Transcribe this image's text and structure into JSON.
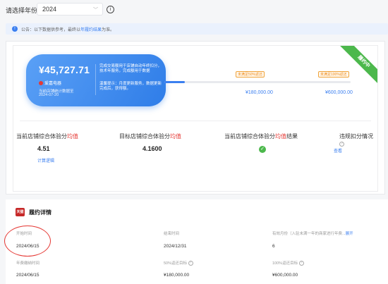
{
  "year_selector": {
    "label": "请选择年份:",
    "value": "2024"
  },
  "notice": {
    "prefix": "公告：以下数据供参考，最终以",
    "link": "年履约结果",
    "suffix": "为准。"
  },
  "card": {
    "amount": "¥45,727.71",
    "brand": "爱嘉电器",
    "sub1": "当前店铺统计数据至",
    "sub2": "2024-07-20",
    "desc": "完成交易额用于店铺自动年终扣分，技术年服务，完成额用于数据",
    "desc2": "温馨提示：月度更新服务，数据更新完成后，获得额。"
  },
  "milestones": [
    {
      "tag": "未满足50%返还",
      "amount": "¥180,000.00"
    },
    {
      "tag": "未满足100%返还",
      "amount": "¥600,000.00"
    }
  ],
  "status_ribbon": "履约中",
  "metrics": [
    {
      "label_a": "当前店铺综合体验分",
      "label_hl": "均值",
      "value": "4.51",
      "link": "计算逻辑"
    },
    {
      "label_a": "目标店铺综合体验分",
      "label_hl": "均值",
      "value": "4.1600"
    },
    {
      "label_a": "当前店铺综合体验分",
      "label_hl": "均值",
      "label_b": "结果"
    },
    {
      "label_a": "违规扣分情况",
      "link": "查看"
    }
  ],
  "progress": {
    "fraction": 0.11
  },
  "details": {
    "title": "履约详情",
    "icon_text": "天猫",
    "rows": [
      {
        "c1": "开始时间",
        "c2": "结束时间",
        "c3": "有效月份（入驻未满一年的商家进行年费...",
        "c3_link": "展开"
      },
      {
        "c1": "2024/06/15",
        "c2": "2024/12/31",
        "c3": "6"
      },
      {
        "c1": "年费缴纳时间",
        "c2": "50%返还目标",
        "c3": "100%返还目标"
      },
      {
        "c1": "2024/06/15",
        "c2": "¥180,000.00",
        "c3": "¥600,000.00"
      }
    ]
  }
}
